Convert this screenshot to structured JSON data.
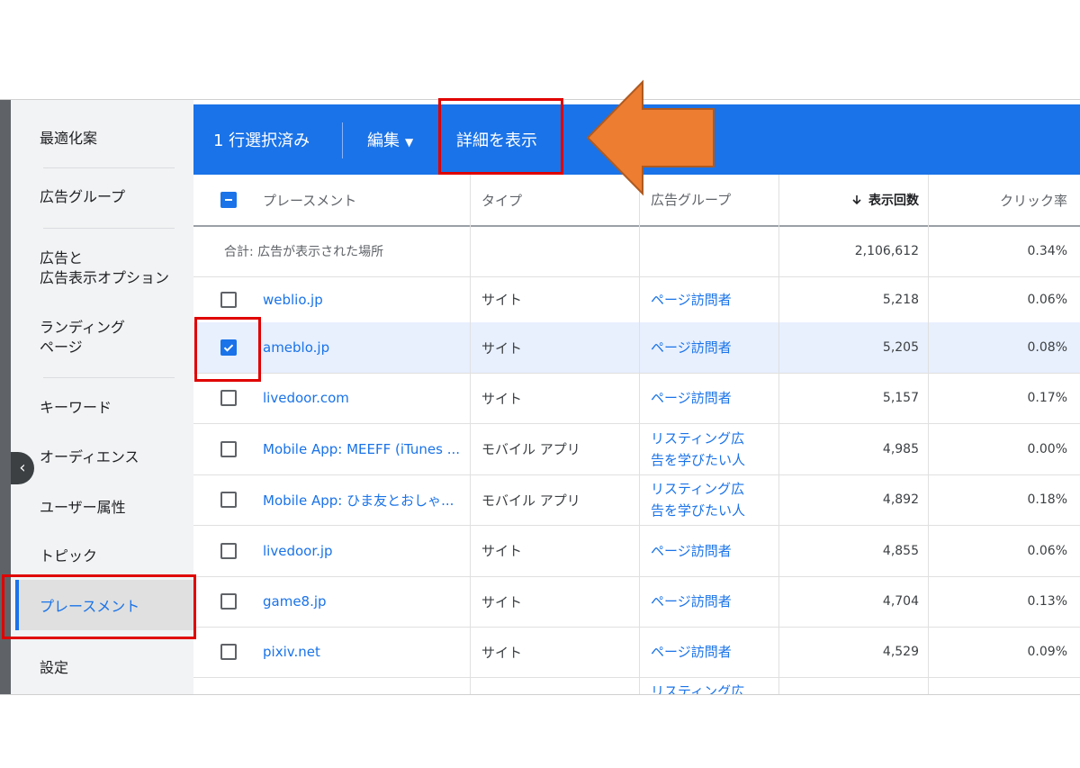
{
  "sidebar": {
    "items": [
      {
        "label": "最適化案"
      },
      {
        "label": "広告グループ"
      },
      {
        "label": "広告と\n広告表示オプション"
      },
      {
        "label": "ランディング\nページ"
      },
      {
        "label": "キーワード"
      },
      {
        "label": "オーディエンス"
      },
      {
        "label": "ユーザー属性"
      },
      {
        "label": "トピック"
      },
      {
        "label": "プレースメント",
        "active": true
      },
      {
        "label": "設定"
      }
    ],
    "collapse_icon": "chevron-left-icon"
  },
  "toolbar": {
    "selected_label": "1 行選択済み",
    "edit_label": "編集",
    "details_label": "詳細を表示"
  },
  "table": {
    "columns": [
      "プレースメント",
      "タイプ",
      "広告グループ",
      "表示回数",
      "クリック率"
    ],
    "sort_icon": "arrow-down-icon",
    "total": {
      "label": "合計: 広告が表示された場所",
      "impressions": "2,106,612",
      "ctr": "0.34%"
    },
    "rows": [
      {
        "placement": "weblio.jp",
        "type": "サイト",
        "ad_group": "ページ訪問者",
        "impressions": "5,218",
        "ctr": "0.06%",
        "checked": false
      },
      {
        "placement": "ameblo.jp",
        "type": "サイト",
        "ad_group": "ページ訪問者",
        "impressions": "5,205",
        "ctr": "0.08%",
        "checked": true
      },
      {
        "placement": "livedoor.com",
        "type": "サイト",
        "ad_group": "ページ訪問者",
        "impressions": "5,157",
        "ctr": "0.17%",
        "checked": false
      },
      {
        "placement": "Mobile App: MEEFF (iTunes ...",
        "type": "モバイル アプリ",
        "ad_group": "リスティング広\n告を学びたい人",
        "impressions": "4,985",
        "ctr": "0.00%",
        "checked": false
      },
      {
        "placement": "Mobile App: ひま友とおしゃ...",
        "type": "モバイル アプリ",
        "ad_group": "リスティング広\n告を学びたい人",
        "impressions": "4,892",
        "ctr": "0.18%",
        "checked": false
      },
      {
        "placement": "livedoor.jp",
        "type": "サイト",
        "ad_group": "ページ訪問者",
        "impressions": "4,855",
        "ctr": "0.06%",
        "checked": false
      },
      {
        "placement": "game8.jp",
        "type": "サイト",
        "ad_group": "ページ訪問者",
        "impressions": "4,704",
        "ctr": "0.13%",
        "checked": false
      },
      {
        "placement": "pixiv.net",
        "type": "サイト",
        "ad_group": "ページ訪問者",
        "impressions": "4,529",
        "ctr": "0.09%",
        "checked": false
      },
      {
        "placement": "",
        "type": "",
        "ad_group": "リスティング広",
        "impressions": "",
        "ctr": "",
        "checked": false
      }
    ]
  },
  "colors": {
    "accent": "#1a73e8",
    "highlight": "#e00000",
    "arrow": "#ed7d31"
  }
}
